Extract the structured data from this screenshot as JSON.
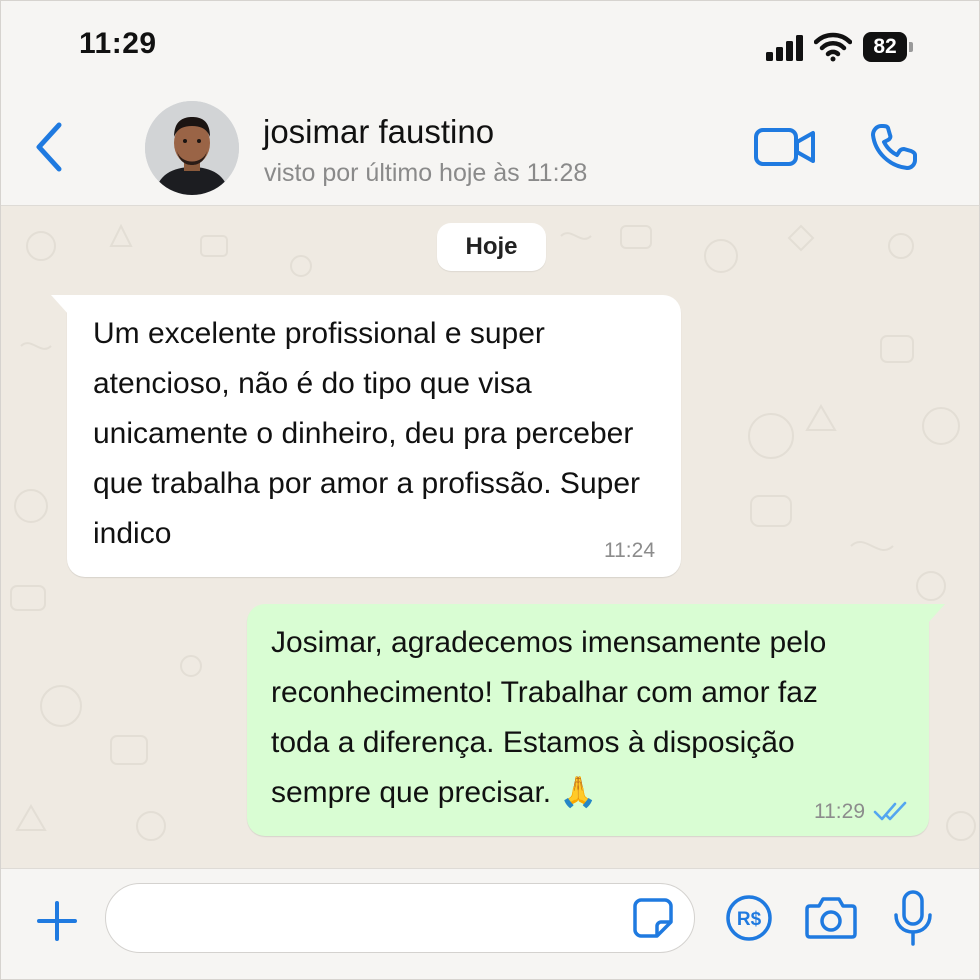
{
  "status_bar": {
    "time": "11:29",
    "battery": "82"
  },
  "header": {
    "contact_name": "josimar faustino",
    "last_seen": "visto por último hoje às 11:28"
  },
  "chat": {
    "date_separator": "Hoje",
    "messages": [
      {
        "direction": "incoming",
        "text": "Um excelente profissional e super\natencioso, não é do tipo que visa\nunicamente o dinheiro, deu pra perceber\nque trabalha por amor a profissão. Super\nindico",
        "time": "11:24"
      },
      {
        "direction": "outgoing",
        "text": "Josimar, agradecemos imensamente pelo\nreconhecimento! Trabalhar com amor faz\ntoda a diferença. Estamos à disposição\nsempre que precisar. 🙏",
        "time": "11:29",
        "status": "read"
      }
    ]
  },
  "input": {
    "value": "",
    "placeholder": ""
  },
  "colors": {
    "accent": "#1f7ae0",
    "chat_background": "#efeae2",
    "incoming_bubble": "#ffffff",
    "outgoing_bubble": "#d9fdd3",
    "read_ticks": "#53a6f0"
  },
  "icons": {
    "back": "chevron-left-icon",
    "video": "video-camera-icon",
    "voice": "phone-icon",
    "plus": "plus-icon",
    "sticker": "sticker-icon",
    "payment": "brl-payment-icon",
    "camera": "camera-icon",
    "mic": "microphone-icon"
  }
}
